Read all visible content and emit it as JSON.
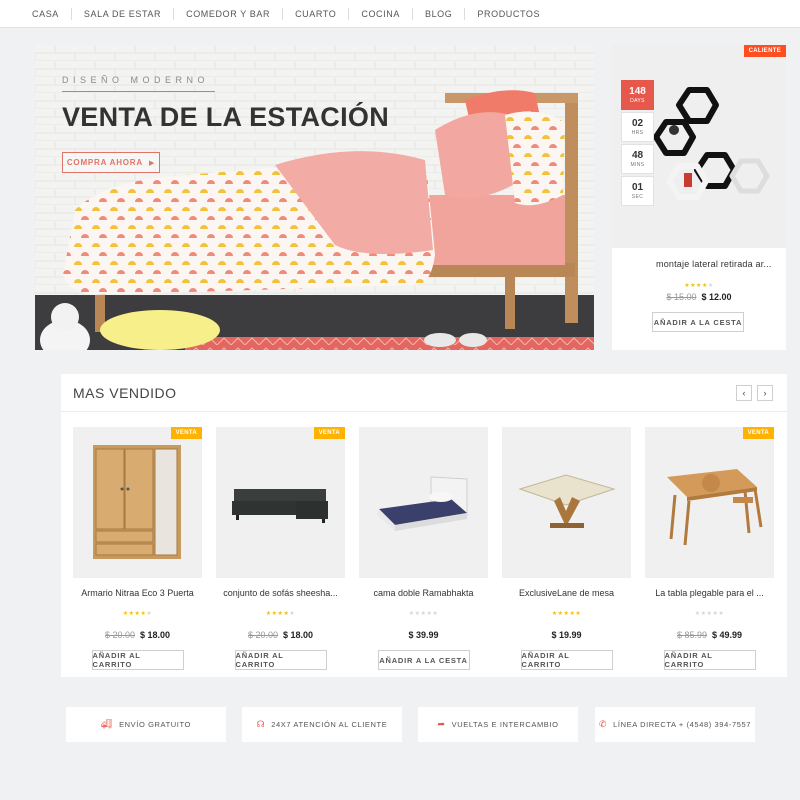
{
  "nav": [
    "CASA",
    "SALA DE ESTAR",
    "COMEDOR Y BAR",
    "CUARTO",
    "COCINA",
    "BLOG",
    "PRODUCTOS"
  ],
  "hero": {
    "kicker": "DISEÑO MODERNO",
    "headline": "VENTA DE LA ESTACIÓN",
    "cta": "COMPRA AHORA"
  },
  "deal": {
    "badge": "CALIENTE",
    "countdown": [
      {
        "num": "148",
        "label": "DAYS"
      },
      {
        "num": "02",
        "label": "HRS"
      },
      {
        "num": "48",
        "label": "MINS"
      },
      {
        "num": "01",
        "label": "SEC"
      }
    ],
    "title": "montaje lateral retirada ar...",
    "rating": 4,
    "old_price": "$ 15.00",
    "price": "$ 12.00",
    "button": "AÑADIR A LA CESTA"
  },
  "best_sellers": {
    "title": "MAS VENDIDO",
    "prev_icon": "chevron-left-icon",
    "next_icon": "chevron-right-icon",
    "products": [
      {
        "name": "Armario Nitraa Eco 3 Puerta",
        "badge": "VENTA",
        "rating": 4,
        "old_price": "$ 20.00",
        "price": "$ 18.00",
        "button": "AÑADIR AL CARRITO",
        "icon": "wardrobe-image"
      },
      {
        "name": "conjunto de sofás sheesha...",
        "badge": "VENTA",
        "rating": 4,
        "old_price": "$ 20.00",
        "price": "$ 18.00",
        "button": "AÑADIR AL CARRITO",
        "icon": "sofa-image"
      },
      {
        "name": "cama doble Ramabhakta",
        "badge": "",
        "rating": 0,
        "old_price": "",
        "price": "$ 39.99",
        "button": "AÑADIR A LA CESTA",
        "icon": "bed-image"
      },
      {
        "name": "ExclusiveLane de mesa",
        "badge": "",
        "rating": 5,
        "old_price": "",
        "price": "$ 19.99",
        "button": "AÑADIR AL CARRITO",
        "icon": "glass-table-image"
      },
      {
        "name": "La tabla plegable para el ...",
        "badge": "VENTA",
        "rating": 0,
        "old_price": "$ 85.99",
        "price": "$ 49.99",
        "button": "AÑADIR AL CARRITO",
        "icon": "laptop-table-image"
      }
    ]
  },
  "services": [
    {
      "icon": "truck-icon",
      "label": "ENVÍO GRATUITO"
    },
    {
      "icon": "headset-icon",
      "label": "24X7 ATENCIÓN AL CLIENTE"
    },
    {
      "icon": "share-arrow-icon",
      "label": "VUELTAS E INTERCAMBIO"
    },
    {
      "icon": "phone-icon",
      "label": "LÍNEA DIRECTA + (4548) 394-7557"
    }
  ],
  "colors": {
    "accent": "#e7584c",
    "hot": "#ff4e20",
    "sale": "#ffb300",
    "star": "#f5c000"
  }
}
